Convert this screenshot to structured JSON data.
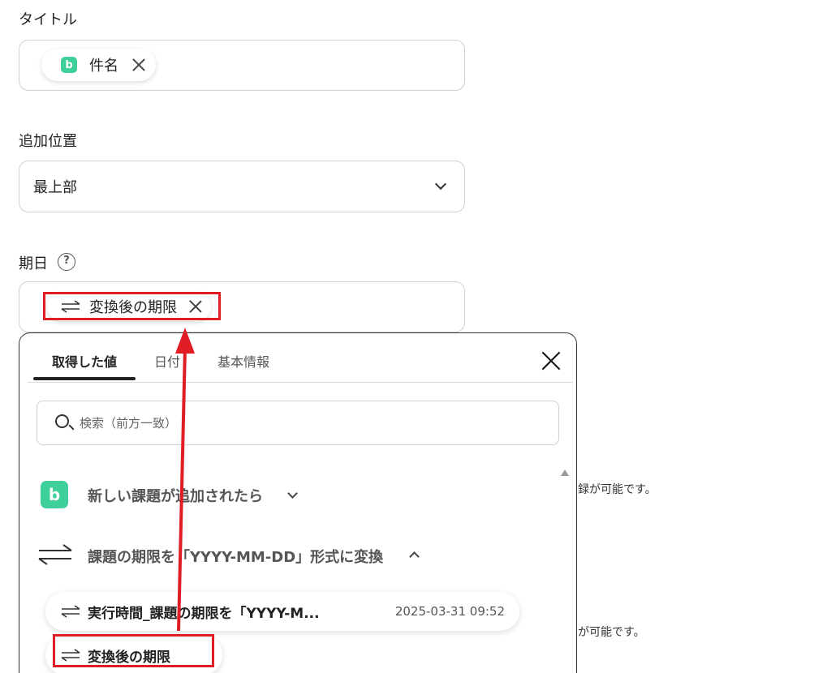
{
  "title_field": {
    "label": "タイトル",
    "chip_label": "件名",
    "chip_icon": "backlog-app-icon"
  },
  "position_field": {
    "label": "追加位置",
    "value": "最上部"
  },
  "due_field": {
    "label": "期日",
    "help_icon": "question-circle-icon",
    "chip_label": "変換後の期限"
  },
  "panel": {
    "tabs": [
      {
        "label": "取得した値",
        "active": true
      },
      {
        "label": "日付",
        "active": false
      },
      {
        "label": "基本情報",
        "active": false
      }
    ],
    "search_placeholder": "検索（前方一致）",
    "sections": [
      {
        "title": "新しい課題が追加されたら",
        "icon": "backlog-app-icon",
        "expanded": false
      },
      {
        "title": "課題の期限を「YYYY-MM-DD」形式に変換",
        "icon": "convert-arrows-icon",
        "expanded": true
      }
    ],
    "items": [
      {
        "label": "実行時間_課題の期限を「YYYY-M...",
        "time": "2025-03-31 09:52"
      },
      {
        "label": "変換後の期限"
      }
    ]
  },
  "side_notes": [
    "録が可能です。",
    "が可能です。"
  ],
  "colors": {
    "accent_green": "#3ecf9a",
    "highlight_red": "#e01d24"
  }
}
